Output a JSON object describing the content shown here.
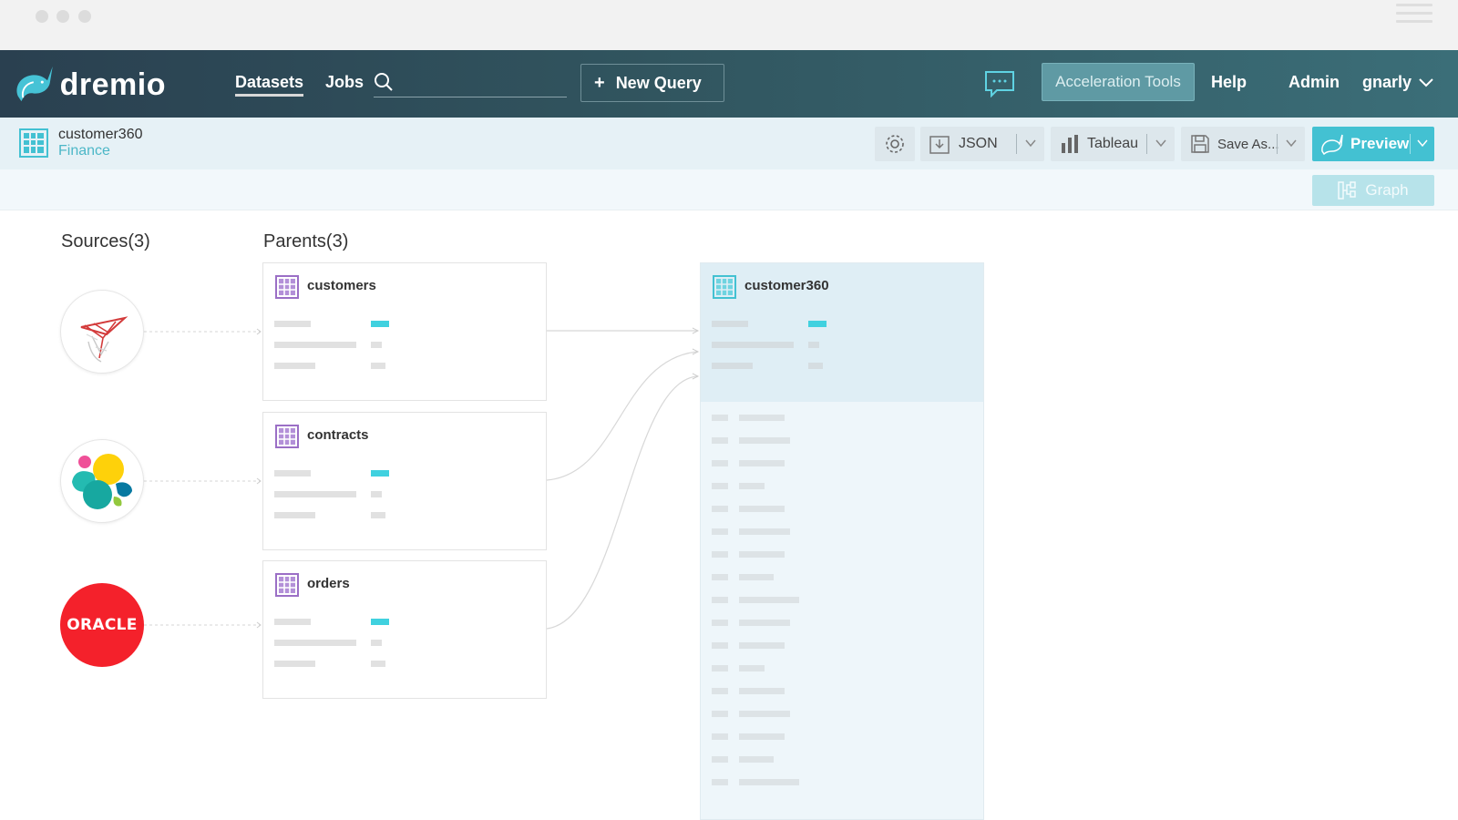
{
  "nav": {
    "logo_text": "dremio",
    "datasets": "Datasets",
    "jobs": "Jobs",
    "new_query": "New Query",
    "acceleration_tools": "Acceleration Tools",
    "help": "Help",
    "admin": "Admin",
    "user": "gnarly"
  },
  "dataset": {
    "name": "customer360",
    "space": "Finance"
  },
  "toolbar": {
    "json": "JSON",
    "tableau": "Tableau",
    "save_as": "Save As...",
    "preview": "Preview",
    "graph": "Graph"
  },
  "lineage": {
    "sources_title": "Sources(3)",
    "parents_title": "Parents(3)",
    "sources": [
      {
        "name": "sql-server-icon"
      },
      {
        "name": "elasticsearch-icon"
      },
      {
        "name": "oracle-icon",
        "text": "ORACLE"
      }
    ],
    "parents": [
      {
        "name": "customers"
      },
      {
        "name": "contracts"
      },
      {
        "name": "orders"
      }
    ],
    "result": {
      "name": "customer360"
    }
  },
  "colors": {
    "accent": "#43c1d2",
    "nav_dark": "#2a4050",
    "nav_light": "#3b6e78",
    "table_icon_parent": "#9b6fc6",
    "table_icon_dataset": "#43c1d2",
    "oracle_red": "#f4212b"
  }
}
